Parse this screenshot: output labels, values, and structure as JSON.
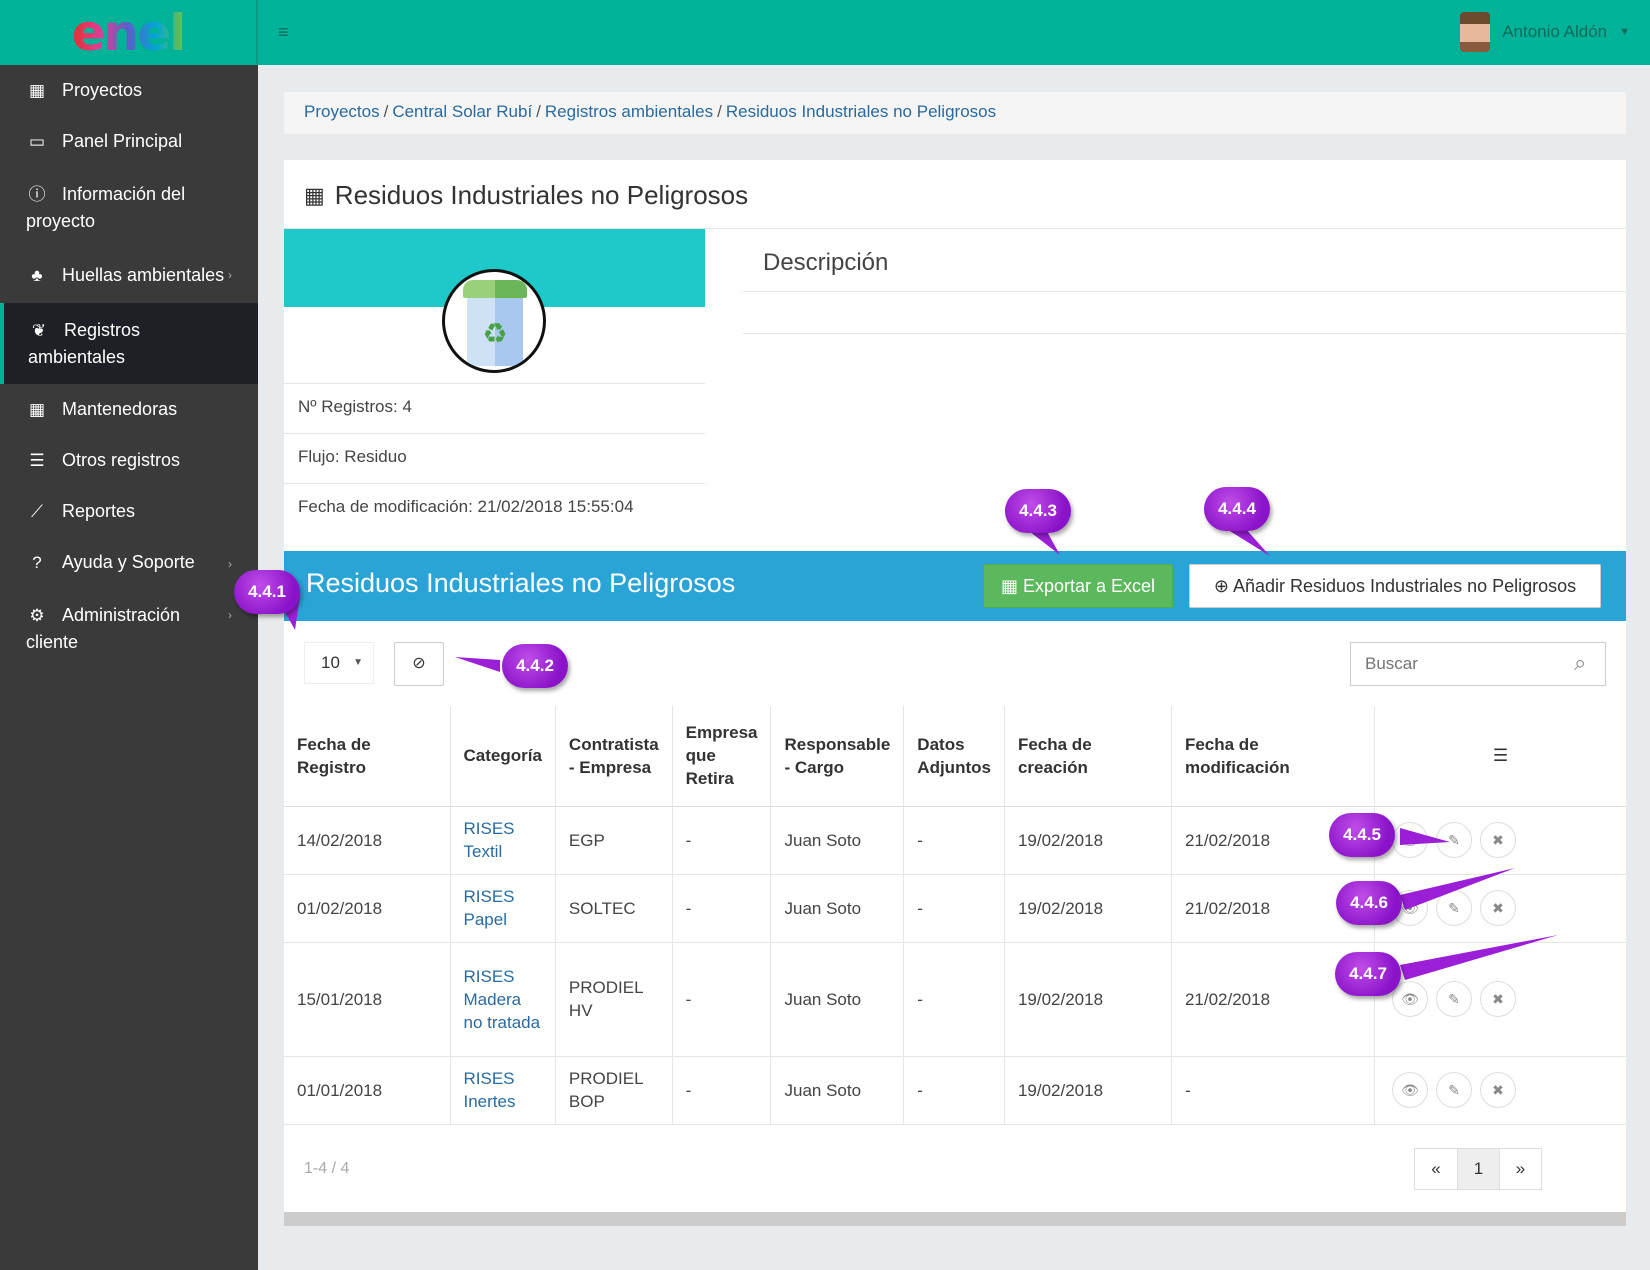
{
  "app": {
    "logo_text": "enel",
    "user_name": "Antonio Aldón",
    "accent": "#00b398"
  },
  "sidebar": {
    "items": [
      {
        "label": "Proyectos",
        "icon": "grid-icon"
      },
      {
        "label": "Panel Principal",
        "icon": "monitor-icon"
      },
      {
        "label": "Información del proyecto",
        "icon": "info-icon"
      },
      {
        "label": "Huellas ambientales",
        "icon": "tree-icon"
      },
      {
        "label": "Registros ambientales",
        "icon": "leaf-icon"
      },
      {
        "label": "Mantenedoras",
        "icon": "table-icon"
      },
      {
        "label": "Otros registros",
        "icon": "list-icon"
      },
      {
        "label": "Reportes",
        "icon": "chart-icon"
      },
      {
        "label": "Ayuda y Soporte",
        "icon": "question-icon"
      },
      {
        "label": "Administración cliente",
        "icon": "gears-icon"
      }
    ]
  },
  "breadcrumb": {
    "items": [
      "Proyectos",
      "Central Solar Rubí",
      "Registros ambientales",
      "Residuos Industriales no Peligrosos"
    ],
    "separator": "/"
  },
  "page": {
    "title": "Residuos Industriales no Peligrosos"
  },
  "card": {
    "registros": "Nº Registros: 4",
    "flujo": "Flujo: Residuo",
    "fecha_mod": "Fecha de modificación: 21/02/2018 15:55:04"
  },
  "description": {
    "title": "Descripción"
  },
  "section": {
    "title": "Residuos Industriales no Peligrosos",
    "export_label": "Exportar a Excel",
    "add_label": "Añadir Residuos Industriales no Peligrosos",
    "per_page": "10",
    "search_placeholder": "Buscar"
  },
  "table": {
    "headers": [
      "Fecha de Registro",
      "Categoría",
      "Contratista - Empresa",
      "Empresa que Retira",
      "Responsable - Cargo",
      "Datos Adjuntos",
      "Fecha de creación",
      "Fecha de modificación"
    ],
    "rows": [
      [
        "14/02/2018",
        "RISES Textil",
        "EGP",
        "-",
        "Juan Soto",
        "-",
        "19/02/2018",
        "21/02/2018"
      ],
      [
        "01/02/2018",
        "RISES Papel",
        "SOLTEC",
        "-",
        "Juan Soto",
        "-",
        "19/02/2018",
        "21/02/2018"
      ],
      [
        "15/01/2018",
        "RISES Madera no tratada",
        "PRODIEL HV",
        "-",
        "Juan Soto",
        "-",
        "19/02/2018",
        "21/02/2018"
      ],
      [
        "01/01/2018",
        "RISES Inertes",
        "PRODIEL BOP",
        "-",
        "Juan Soto",
        "-",
        "19/02/2018",
        "-"
      ]
    ]
  },
  "pagination": {
    "info": "1-4 / 4",
    "prev": "«",
    "current": "1",
    "next": "»"
  },
  "callouts": [
    "4.4.1",
    "4.4.2",
    "4.4.3",
    "4.4.4",
    "4.4.5",
    "4.4.6",
    "4.4.7"
  ]
}
